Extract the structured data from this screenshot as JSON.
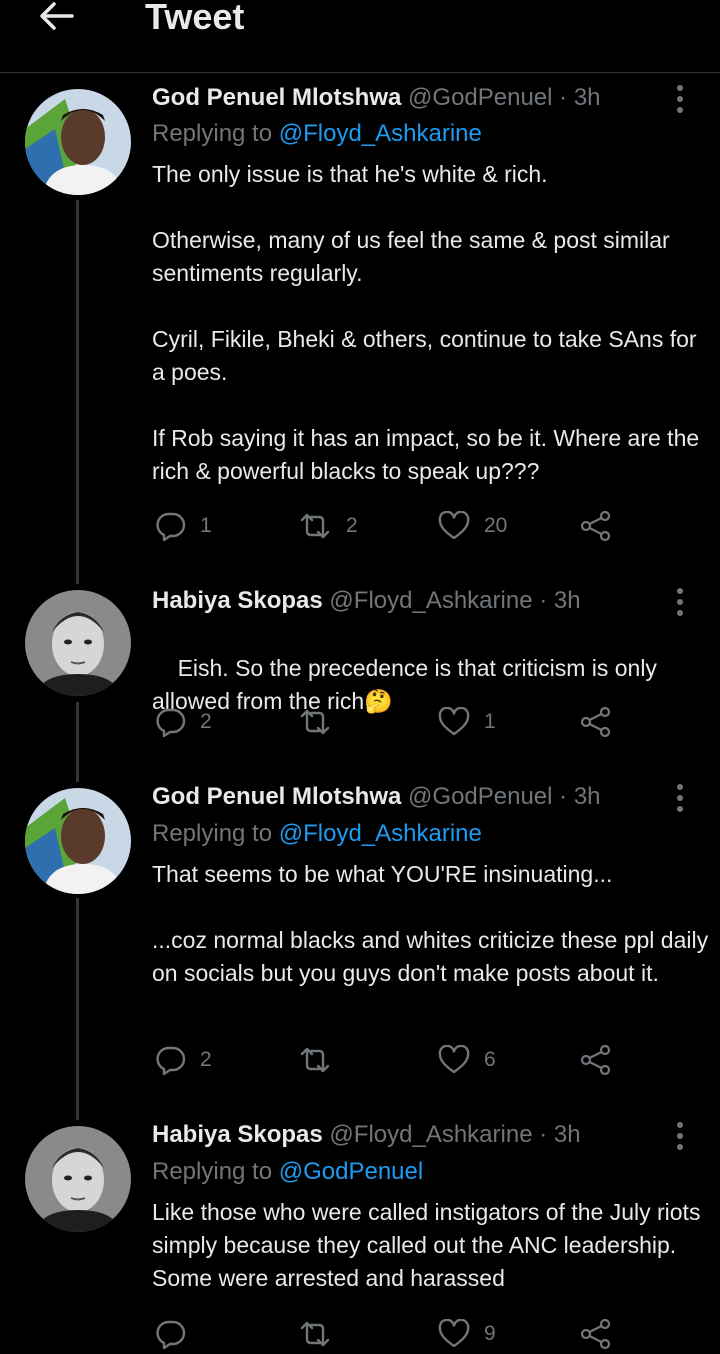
{
  "header": {
    "title": "Tweet"
  },
  "tweets": [
    {
      "name": "God Penuel Mlotshwa",
      "handle": "@GodPenuel",
      "time": "· 3h",
      "replying_prefix": "Replying to ",
      "replying_to": "@Floyd_Ashkarine",
      "text": "The only issue is that he's white & rich.\n\nOtherwise, many of us feel the same & post similar sentiments regularly.\n\nCyril, Fikile, Bheki & others, continue to take SAns for a poes.\n\nIf Rob saying it has an impact, so be it. Where are the rich & powerful blacks to speak up???",
      "replies": "1",
      "retweets": "2",
      "likes": "20"
    },
    {
      "name": "Habiya Skopas",
      "handle": "@Floyd_Ashkarine",
      "time": "· 3h",
      "text": "Eish. So the precedence is that criticism is only allowed from the rich",
      "emoji": "🤔",
      "replies": "2",
      "retweets": "",
      "likes": "1"
    },
    {
      "name": "God Penuel Mlotshwa",
      "handle": "@GodPenuel",
      "time": "· 3h",
      "replying_prefix": "Replying to ",
      "replying_to": "@Floyd_Ashkarine",
      "text": "That seems to be what YOU'RE insinuating...\n\n...coz normal blacks and whites criticize these ppl daily on socials but you guys don't make posts about it.",
      "replies": "2",
      "retweets": "",
      "likes": "6"
    },
    {
      "name": "Habiya Skopas",
      "handle": "@Floyd_Ashkarine",
      "time": "· 3h",
      "replying_prefix": "Replying to ",
      "replying_to": "@GodPenuel",
      "text": "Like those who were called instigators of the July riots simply because they called out the ANC leadership. Some were arrested and harassed",
      "replies": "",
      "retweets": "",
      "likes": "9"
    }
  ],
  "colors": {
    "background": "#000000",
    "text": "#e7e9ea",
    "muted": "#71767b",
    "link": "#1d9bf0",
    "divider": "#2f3336"
  }
}
